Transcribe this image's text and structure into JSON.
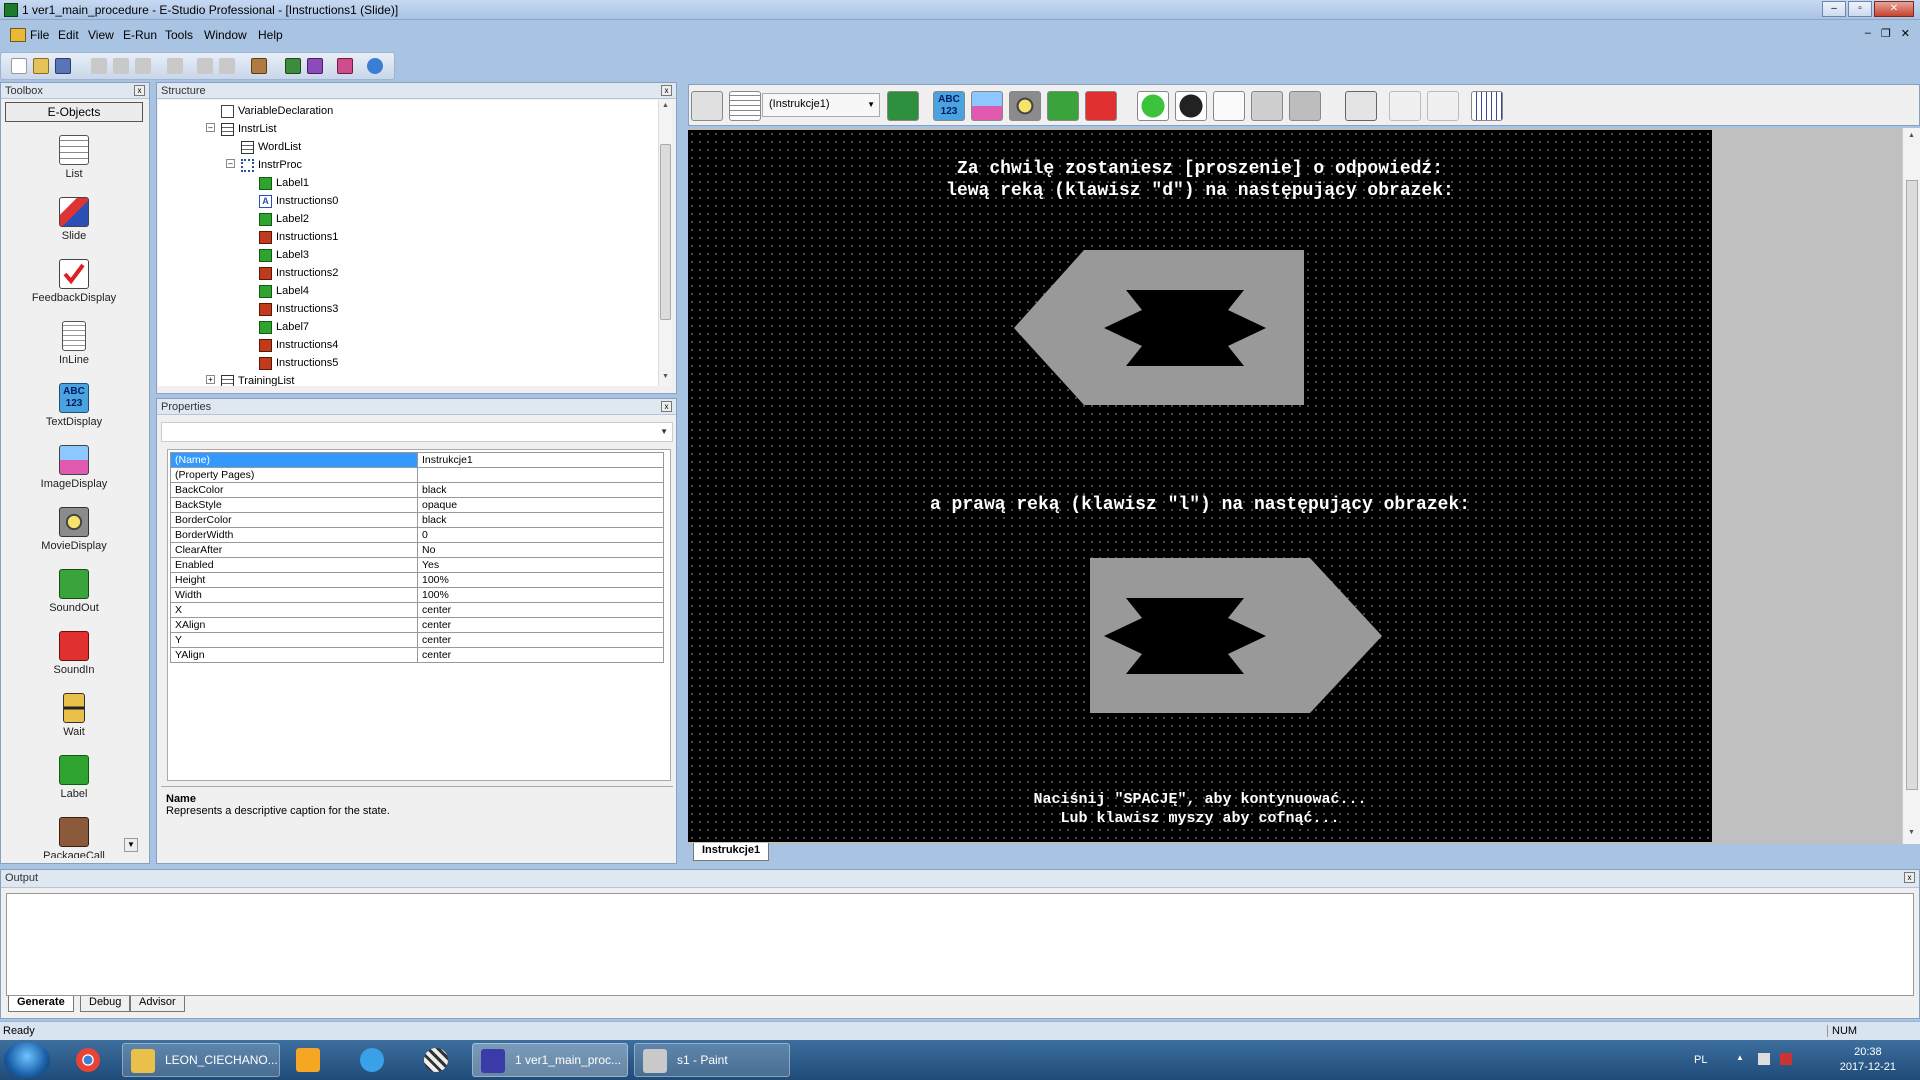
{
  "window": {
    "title": "1 ver1_main_procedure - E-Studio Professional - [Instructions1  (Slide)]",
    "buttons": {
      "minimize": "–",
      "maximize": "▫",
      "close": "✕"
    }
  },
  "menu": {
    "items": [
      "File",
      "Edit",
      "View",
      "E-Run",
      "Tools",
      "Window",
      "Help"
    ],
    "mdi": {
      "minimize": "–",
      "restore": "❐",
      "close": "✕"
    }
  },
  "toolbox": {
    "title": "Toolbox",
    "header": "E-Objects",
    "items": [
      "List",
      "Slide",
      "FeedbackDisplay",
      "InLine",
      "TextDisplay",
      "ImageDisplay",
      "MovieDisplay",
      "SoundOut",
      "SoundIn",
      "Wait",
      "Label",
      "PackageCall"
    ],
    "textdisplay_icon_label": "ABC\n123"
  },
  "structure": {
    "title": "Structure",
    "rows": [
      "VariableDeclaration",
      "InstrList",
      "WordList",
      "InstrProc",
      "Label1",
      "Instructions0",
      "Label2",
      "Instructions1",
      "Label3",
      "Instructions2",
      "Label4",
      "Instructions3",
      "Label7",
      "Instructions4",
      "Instructions5",
      "TrainingList"
    ],
    "icon_letter": "A"
  },
  "properties": {
    "title": "Properties",
    "rows": [
      {
        "key": "(Name)",
        "value": "Instrukcje1"
      },
      {
        "key": "(Property Pages)",
        "value": ""
      },
      {
        "key": "BackColor",
        "value": "black"
      },
      {
        "key": "BackStyle",
        "value": "opaque"
      },
      {
        "key": "BorderColor",
        "value": "black"
      },
      {
        "key": "BorderWidth",
        "value": "0"
      },
      {
        "key": "ClearAfter",
        "value": "No"
      },
      {
        "key": "Enabled",
        "value": "Yes"
      },
      {
        "key": "Height",
        "value": "100%"
      },
      {
        "key": "Width",
        "value": "100%"
      },
      {
        "key": "X",
        "value": "center"
      },
      {
        "key": "XAlign",
        "value": "center"
      },
      {
        "key": "Y",
        "value": "center"
      },
      {
        "key": "YAlign",
        "value": "center"
      }
    ],
    "desc_title": "Name",
    "desc_text": "Represents a descriptive caption for the state."
  },
  "editor": {
    "combo_value": "(Instrukcje1)",
    "textdisplay_icon_label": "ABC\n123",
    "slide_texts": {
      "line1": "Za chwilę zostaniesz [proszenie] o odpowiedź:",
      "line2": "lewą reką (klawisz \"d\") na następujący obrazek:",
      "line3": "a prawą reką (klawisz \"l\") na następujący obrazek:",
      "line4": "Naciśnij \"SPACJĘ\", aby kontynuować...",
      "line5": "Lub klawisz myszy aby cofnąć..."
    },
    "tab": "Instrukcje1"
  },
  "output": {
    "title": "Output",
    "tabs": [
      "Generate",
      "Debug",
      "Advisor"
    ]
  },
  "status": {
    "left": "Ready",
    "right": "NUM"
  },
  "taskbar": {
    "apps": [
      "LEON_CIECHANO...",
      "1 ver1_main_proc...",
      "s1 - Paint"
    ],
    "lang": "PL",
    "time": "20:38",
    "date": "2017-12-21"
  },
  "colors": {
    "accent": "#3399ff",
    "slide_bg": "#000000",
    "shape_gray": "#999999",
    "taskbar": "#1f4b78"
  }
}
